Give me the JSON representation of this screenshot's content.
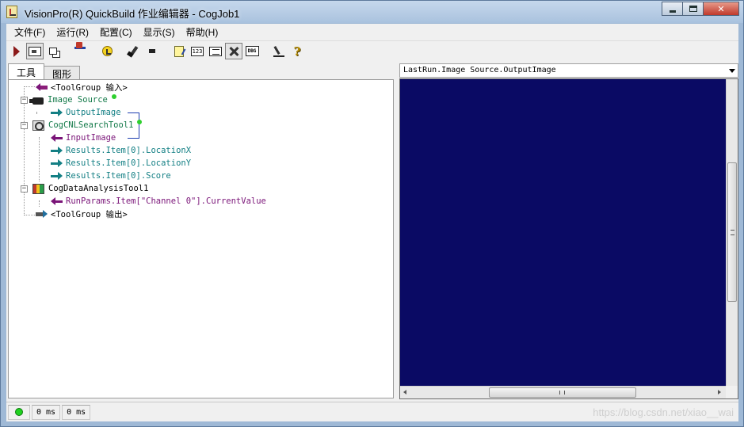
{
  "window": {
    "title": "VisionPro(R) QuickBuild 作业编辑器 - CogJob1",
    "app_icon": "vision-app-icon"
  },
  "menu": [
    {
      "label": "文件(F)"
    },
    {
      "label": "运行(R)"
    },
    {
      "label": "配置(C)"
    },
    {
      "label": "显示(S)"
    },
    {
      "label": "帮助(H)"
    }
  ],
  "toolbar": {
    "icons": [
      "run-icon",
      "image-display-icon",
      "dual-window-icon",
      "reset-icon",
      "refresh-icon",
      "brush-icon",
      "small-tool-icon",
      "note-icon",
      "numeric-display-icon",
      "list-display-icon",
      "tools-icon",
      "debug-icon",
      "pen-icon",
      "help-icon"
    ]
  },
  "tabs": [
    {
      "label": "工具",
      "active": true
    },
    {
      "label": "图形",
      "active": false
    }
  ],
  "tree": {
    "input_group": "<ToolGroup 输入>",
    "image_source": "Image Source",
    "output_image": "OutputImage",
    "cnl_tool": "CogCNLSearchTool1",
    "input_image": "InputImage",
    "loc_x": "Results.Item[0].LocationX",
    "loc_y": "Results.Item[0].LocationY",
    "score": "Results.Item[0].Score",
    "data_tool": "CogDataAnalysisTool1",
    "run_params": "RunParams.Item[\"Channel 0\"].CurrentValue",
    "output_group": "<ToolGroup 输出>"
  },
  "image_view": {
    "selected_source": "LastRun.Image Source.OutputImage",
    "background_color": "#0a0a64"
  },
  "status": {
    "indicator_color": "#1fd11f",
    "time_1": "0 ms",
    "time_2": "0 ms",
    "watermark": "https://blog.csdn.net/xiao__wai"
  },
  "colors": {
    "tool_text": "#147a4a",
    "output_text": "#137f84",
    "input_text": "#7a1478",
    "link_line": "#1f3fb0"
  }
}
